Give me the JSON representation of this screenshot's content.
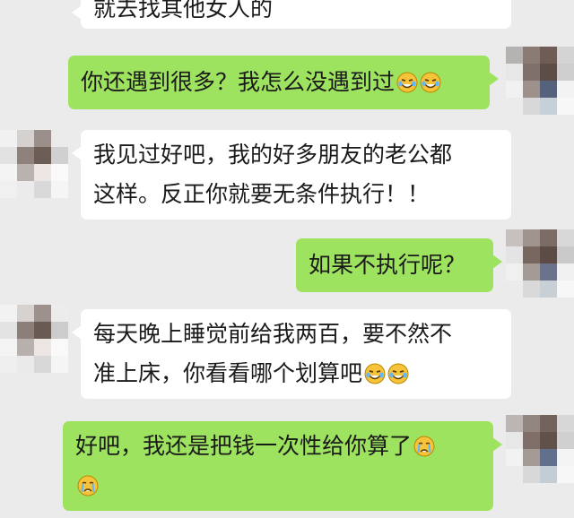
{
  "colors": {
    "background": "#ebebeb",
    "incoming_bubble": "#ffffff",
    "outgoing_bubble": "#9ee35f",
    "text": "#1a1a1a"
  },
  "messages": [
    {
      "direction": "incoming",
      "lines": [
        "就去找其他女人的"
      ]
    },
    {
      "direction": "outgoing",
      "lines": [
        "你还遇到很多？我怎么没遇到过"
      ],
      "emojis": [
        "laugh-crying-emoji",
        "laugh-crying-emoji"
      ]
    },
    {
      "direction": "incoming",
      "lines": [
        "我见过好吧，我的好多朋友的老公都",
        "这样。反正你就要无条件执行！！"
      ]
    },
    {
      "direction": "outgoing",
      "lines": [
        "如果不执行呢？"
      ]
    },
    {
      "direction": "incoming",
      "lines": [
        "每天晚上睡觉前给我两百，要不然不",
        "准上床，你看看哪个划算吧"
      ],
      "emojis": [
        "laugh-crying-emoji",
        "laugh-crying-emoji"
      ]
    },
    {
      "direction": "outgoing",
      "lines": [
        "好吧，我还是把钱一次性给你算了"
      ],
      "emojis": [
        "crying-emoji",
        "crying-emoji"
      ]
    }
  ]
}
